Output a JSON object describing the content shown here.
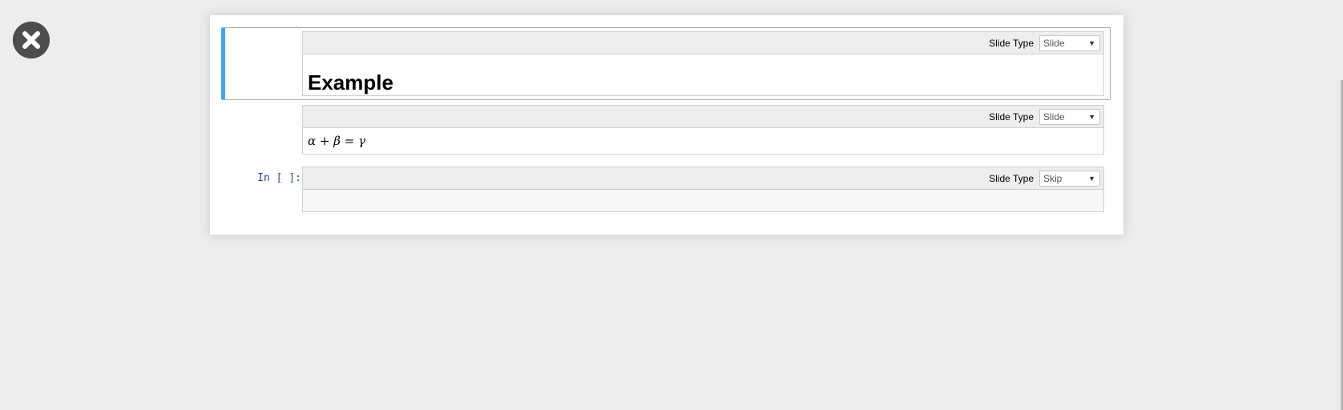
{
  "close_button": {
    "icon": "close-icon",
    "color": "#4d4d4d"
  },
  "toolbar_label": "Slide Type",
  "cells": [
    {
      "type": "markdown",
      "selected": true,
      "slide_type": "Slide",
      "heading": "Example"
    },
    {
      "type": "markdown",
      "selected": false,
      "slide_type": "Slide",
      "math": {
        "alpha": "α",
        "plus": "+",
        "beta": "β",
        "equals": "=",
        "gamma": "γ"
      }
    },
    {
      "type": "code",
      "selected": false,
      "prompt": "In [ ]:",
      "slide_type": "Skip",
      "code": ""
    }
  ],
  "colors": {
    "selection_border": "#42a5f5",
    "prompt": "#303f9f",
    "background": "#ededed"
  }
}
